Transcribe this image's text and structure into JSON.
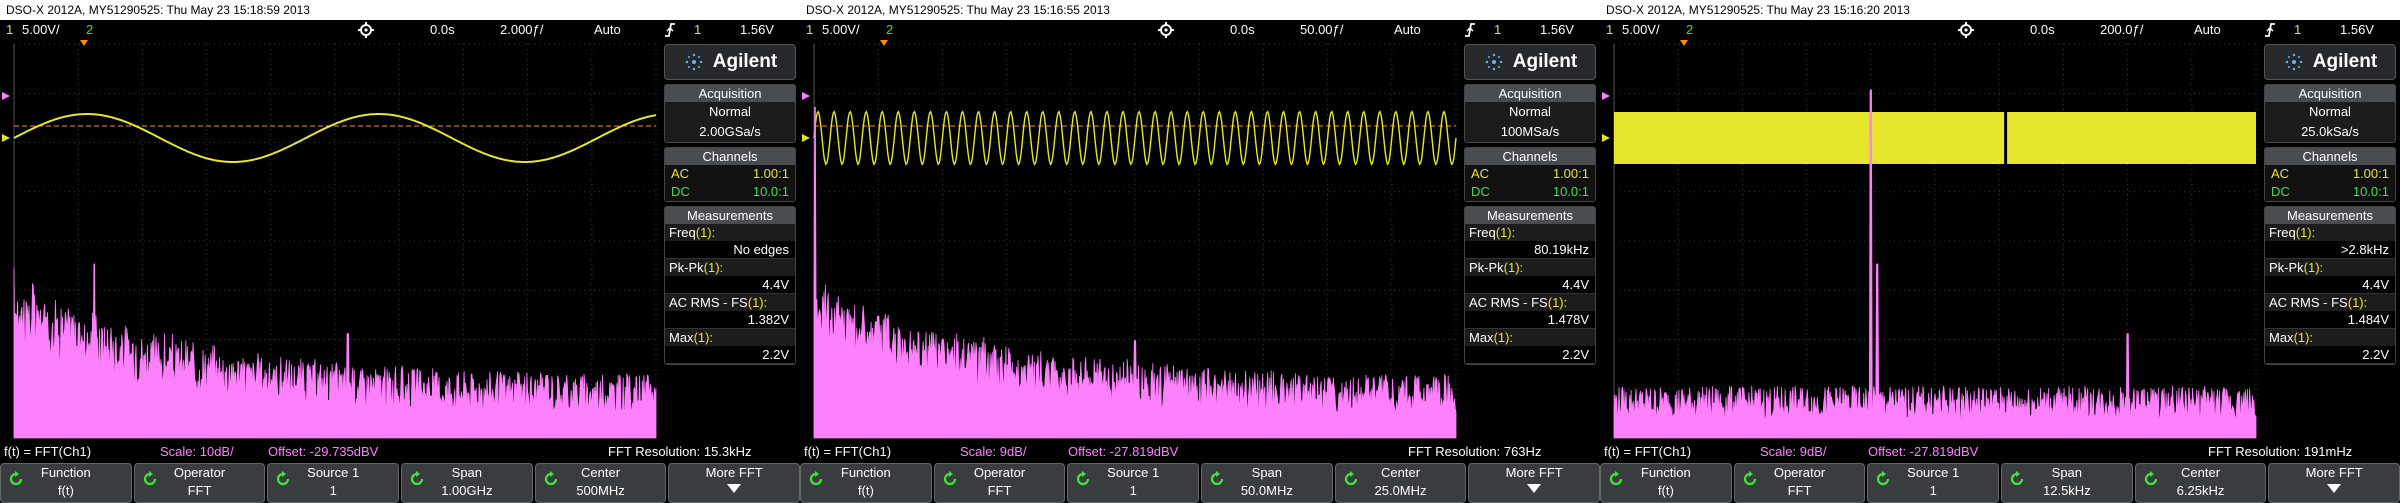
{
  "colors": {
    "ch1": "#e6e62d",
    "ch2": "#3ee63e",
    "math": "#ff80ff",
    "trigger": "#ff8a00",
    "grid": "#3a3a3a"
  },
  "scopes": [
    {
      "title": "DSO-X 2012A, MY51290525: Thu May 23 15:18:59 2013",
      "status": {
        "ch1_num": "1",
        "ch1_scale": "5.00V/",
        "ch2_num": "2",
        "delay": "0.0s",
        "timebase": "2.000ƒ/",
        "trig_mode": "Auto",
        "trig_num": "1",
        "trig_level": "1.56V"
      },
      "panel": {
        "brand": "Agilent",
        "acq_head": "Acquisition",
        "acq_mode": "Normal",
        "acq_rate": "2.00GSa/s",
        "ch_head": "Channels",
        "ch1_coupling": "AC",
        "ch1_probe": "1.00:1",
        "ch2_coupling": "DC",
        "ch2_probe": "10.0:1",
        "meas_head": "Measurements",
        "freq_label": "Freq",
        "freq_val": "No edges",
        "pkpk_label": "Pk-Pk",
        "pkpk_val": "4.4V",
        "acrms_label": "AC RMS - FS",
        "acrms_val": "1.382V",
        "max_label": "Max",
        "max_val": "2.2V",
        "meas_idx": "(1):"
      },
      "math": {
        "func": "f(t) = FFT(Ch1)",
        "scale": "Scale: 10dB/",
        "offset": "Offset: -29.735dBV",
        "res": "FFT Resolution: 15.3kHz"
      },
      "softkeys": {
        "function_label": "Function",
        "function_val": "f(t)",
        "operator_label": "Operator",
        "operator_val": "FFT",
        "source_label": "Source 1",
        "source_val": "1",
        "span_label": "Span",
        "span_val": "1.00GHz",
        "center_label": "Center",
        "center_val": "500MHz",
        "more_label": "More FFT"
      },
      "trace": {
        "kind": "sine",
        "cycles": 2.2,
        "amplitude": 0.5
      },
      "spectrum": {
        "peaks": [
          {
            "pos": 0.125,
            "height": 0.5
          },
          {
            "pos": 0.52,
            "height": 0.3
          },
          {
            "pos": 0.83,
            "height": 0.18
          }
        ],
        "floor": 0.12,
        "decay": true
      }
    },
    {
      "title": "DSO-X 2012A, MY51290525: Thu May 23 15:16:55 2013",
      "status": {
        "ch1_num": "1",
        "ch1_scale": "5.00V/",
        "ch2_num": "2",
        "delay": "0.0s",
        "timebase": "50.00ƒ/",
        "trig_mode": "Auto",
        "trig_num": "1",
        "trig_level": "1.56V"
      },
      "panel": {
        "brand": "Agilent",
        "acq_head": "Acquisition",
        "acq_mode": "Normal",
        "acq_rate": "100MSa/s",
        "ch_head": "Channels",
        "ch1_coupling": "AC",
        "ch1_probe": "1.00:1",
        "ch2_coupling": "DC",
        "ch2_probe": "10.0:1",
        "meas_head": "Measurements",
        "freq_label": "Freq",
        "freq_val": "80.19kHz",
        "pkpk_label": "Pk-Pk",
        "pkpk_val": "4.4V",
        "acrms_label": "AC RMS - FS",
        "acrms_val": "1.478V",
        "max_label": "Max",
        "max_val": "2.2V",
        "meas_idx": "(1):"
      },
      "math": {
        "func": "f(t) = FFT(Ch1)",
        "scale": "Scale: 9dB/",
        "offset": "Offset: -27.819dBV",
        "res": "FFT Resolution: 763Hz"
      },
      "softkeys": {
        "function_label": "Function",
        "function_val": "f(t)",
        "operator_label": "Operator",
        "operator_val": "FFT",
        "source_label": "Source 1",
        "source_val": "1",
        "span_label": "Span",
        "span_val": "50.0MHz",
        "center_label": "Center",
        "center_val": "25.0MHz",
        "more_label": "More FFT"
      },
      "trace": {
        "kind": "sine",
        "cycles": 40,
        "amplitude": 0.55
      },
      "spectrum": {
        "peaks": [
          {
            "pos": 0.002,
            "height": 0.95
          },
          {
            "pos": 0.1,
            "height": 0.35
          },
          {
            "pos": 0.5,
            "height": 0.28
          }
        ],
        "floor": 0.12,
        "decay": true
      }
    },
    {
      "title": "DSO-X 2012A, MY51290525: Thu May 23 15:16:20 2013",
      "status": {
        "ch1_num": "1",
        "ch1_scale": "5.00V/",
        "ch2_num": "2",
        "delay": "0.0s",
        "timebase": "200.0ƒ/",
        "trig_mode": "Auto",
        "trig_num": "1",
        "trig_level": "1.56V"
      },
      "panel": {
        "brand": "Agilent",
        "acq_head": "Acquisition",
        "acq_mode": "Normal",
        "acq_rate": "25.0kSa/s",
        "ch_head": "Channels",
        "ch1_coupling": "AC",
        "ch1_probe": "1.00:1",
        "ch2_coupling": "DC",
        "ch2_probe": "10.0:1",
        "meas_head": "Measurements",
        "freq_label": "Freq",
        "freq_val": ">2.8kHz",
        "pkpk_label": "Pk-Pk",
        "pkpk_val": "4.4V",
        "acrms_label": "AC RMS - FS",
        "acrms_val": "1.484V",
        "max_label": "Max",
        "max_val": "2.2V",
        "meas_idx": "(1):"
      },
      "math": {
        "func": "f(t) = FFT(Ch1)",
        "scale": "Scale: 9dB/",
        "offset": "Offset: -27.819dBV",
        "res": "FFT Resolution: 191mHz"
      },
      "softkeys": {
        "function_label": "Function",
        "function_val": "f(t)",
        "operator_label": "Operator",
        "operator_val": "FFT",
        "source_label": "Source 1",
        "source_val": "1",
        "span_label": "Span",
        "span_val": "12.5kHz",
        "center_label": "Center",
        "center_val": "6.25kHz",
        "more_label": "More FFT"
      },
      "trace": {
        "kind": "band",
        "cycles": 0,
        "amplitude": 0.55
      },
      "spectrum": {
        "peaks": [
          {
            "pos": 0.4,
            "height": 1.0
          },
          {
            "pos": 0.41,
            "height": 0.5
          },
          {
            "pos": 0.8,
            "height": 0.3
          }
        ],
        "floor": 0.1,
        "decay": false
      }
    }
  ]
}
